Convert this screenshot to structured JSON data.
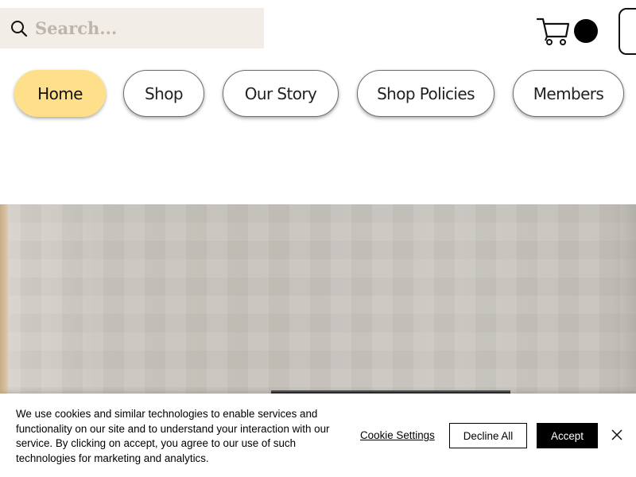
{
  "header": {
    "search": {
      "placeholder": "Search...",
      "value": ""
    },
    "icons": {
      "search": "search-icon",
      "cart": "cart-icon",
      "avatar": "avatar",
      "login": "login-button"
    }
  },
  "nav": {
    "items": [
      {
        "label": "Home",
        "active": true
      },
      {
        "label": "Shop",
        "active": false
      },
      {
        "label": "Our Story",
        "active": false
      },
      {
        "label": "Shop Policies",
        "active": false
      },
      {
        "label": "Members",
        "active": false
      }
    ]
  },
  "cookie_banner": {
    "text": "We use cookies and similar technologies to enable services and functionality on our site and to understand your interaction with our service. By clicking on accept, you agree to our use of such technologies for marketing and analytics.",
    "settings_label": "Cookie Settings",
    "decline_label": "Decline All",
    "accept_label": "Accept",
    "close_icon": "close-icon"
  },
  "colors": {
    "active_nav": "#ffe08a",
    "search_bg": "#f2ede6",
    "accept_bg": "#000000"
  }
}
